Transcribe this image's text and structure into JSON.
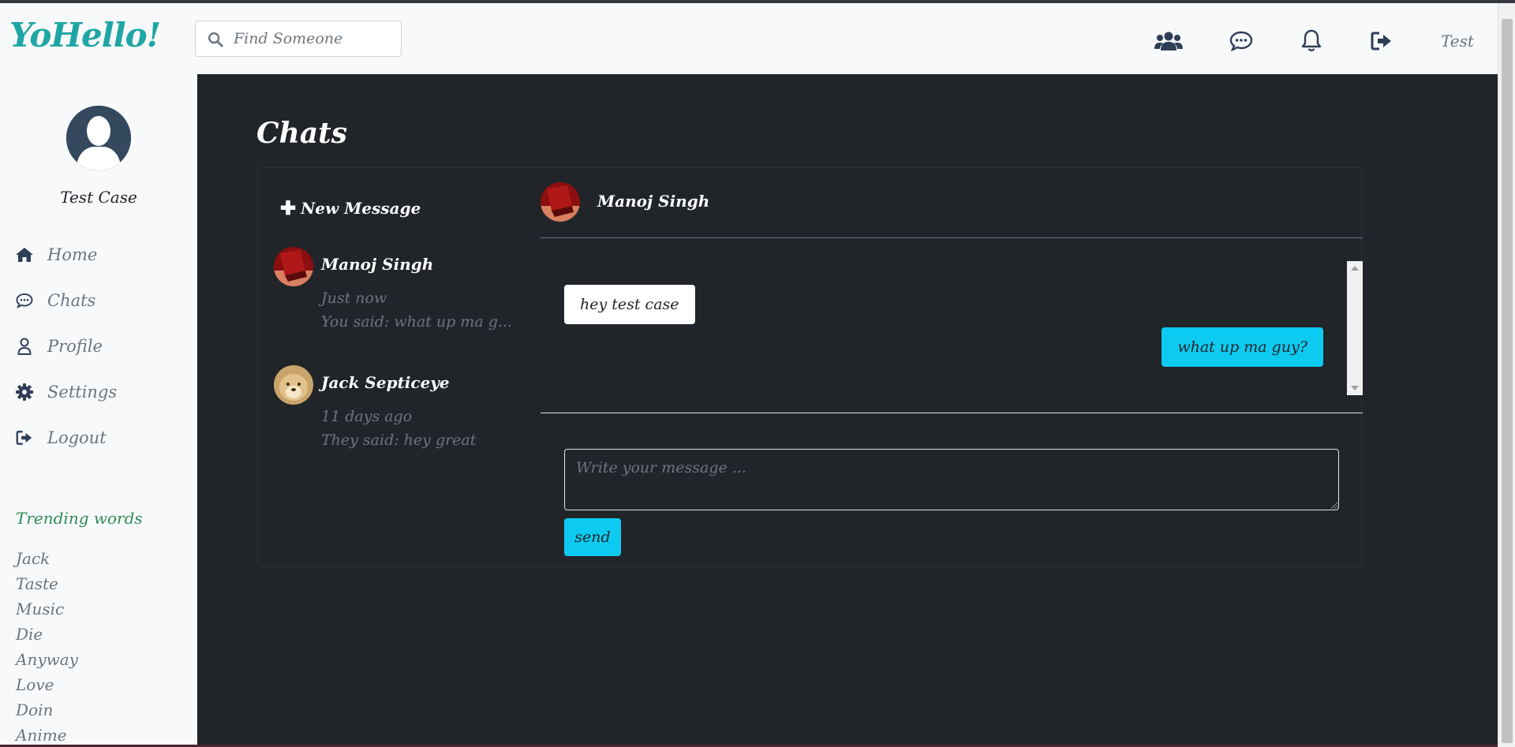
{
  "app": {
    "brand": "YoHello!"
  },
  "search": {
    "placeholder": "Find Someone"
  },
  "navbar": {
    "icons": [
      "users-icon",
      "chat-icon",
      "bell-icon",
      "sign-out-icon"
    ],
    "username": "Test"
  },
  "sidebar": {
    "username": "Test Case",
    "menu": [
      {
        "label": "Home",
        "icon": "home-icon"
      },
      {
        "label": "Chats",
        "icon": "chat-icon"
      },
      {
        "label": "Profile",
        "icon": "user-icon"
      },
      {
        "label": "Settings",
        "icon": "gear-icon"
      },
      {
        "label": "Logout",
        "icon": "sign-out-icon"
      }
    ],
    "trending_title": "Trending words",
    "trending": [
      "Jack",
      "Taste",
      "Music",
      "Die",
      "Anyway",
      "Love",
      "Doin",
      "Anime"
    ]
  },
  "main": {
    "title": "Chats",
    "new_message": "New Message",
    "conversations": [
      {
        "name": "Manoj Singh",
        "time": "Just now",
        "preview": "You said: what up ma g..."
      },
      {
        "name": "Jack Septiceye",
        "time": "11 days ago",
        "preview": "They said: hey great"
      }
    ],
    "active": {
      "name": "Manoj Singh",
      "messages": [
        {
          "direction": "in",
          "text": "hey test case"
        },
        {
          "direction": "out",
          "text": "what up ma guy?"
        }
      ]
    },
    "composer": {
      "placeholder": "Write your message ...",
      "value": ""
    },
    "send_label": "send"
  },
  "colors": {
    "brand": "#20a5a5",
    "main_bg": "#212529",
    "sidebar_bg": "#f8f9fa",
    "accent": "#0dcaf0",
    "trending_title": "#2e8b57",
    "muted": "#6c757d"
  }
}
